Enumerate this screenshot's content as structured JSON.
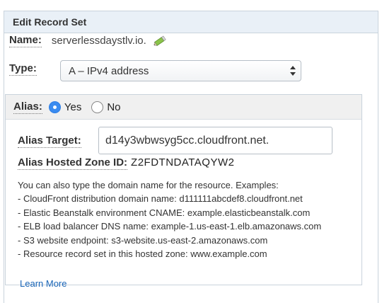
{
  "panel": {
    "title": "Edit Record Set"
  },
  "name": {
    "label": "Name:",
    "value": "serverlessdaystlv.io."
  },
  "type": {
    "label": "Type:",
    "selected": "A – IPv4 address"
  },
  "alias": {
    "label": "Alias:",
    "yes_label": "Yes",
    "no_label": "No",
    "selected": "Yes",
    "target_label": "Alias Target:",
    "target_value": "d14y3wbwsyg5cc.cloudfront.net.",
    "zone_label": "Alias Hosted Zone ID:",
    "zone_value": "Z2FDTNDATAQYW2",
    "help_intro": "You can also type the domain name for the resource. Examples:",
    "examples": [
      "CloudFront distribution domain name: d111111abcdef8.cloudfront.net",
      "Elastic Beanstalk environment CNAME: example.elasticbeanstalk.com",
      "ELB load balancer DNS name: example-1.us-east-1.elb.amazonaws.com",
      "S3 website endpoint: s3-website.us-east-2.amazonaws.com",
      "Resource record set in this hosted zone: www.example.com"
    ],
    "learn_more": "Learn More"
  },
  "colors": {
    "header_bg": "#e9f0f7",
    "radio_selected": "#3b8cf0",
    "link": "#1a66b8",
    "pencil": "#7cb342"
  },
  "icons": {
    "edit": "pencil-icon",
    "select": "updown-arrows-icon"
  }
}
